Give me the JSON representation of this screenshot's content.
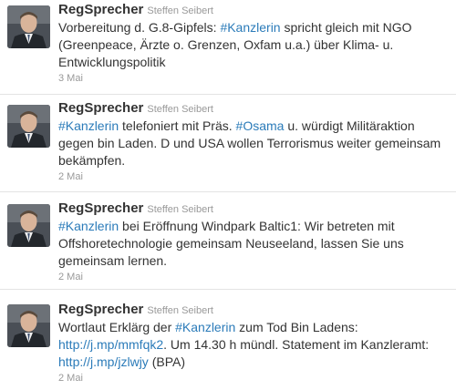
{
  "tweets": [
    {
      "screen_name": "RegSprecher",
      "full_name": "Steffen Seibert",
      "timestamp": "3 Mai",
      "parts": [
        {
          "t": "Vorbereitung d. G.8-Gipfels: "
        },
        {
          "t": "#Kanzlerin",
          "link": true
        },
        {
          "t": " spricht gleich mit NGO (Greenpeace, Ärzte o. Grenzen, Oxfam u.a.) über Klima- u. Entwicklungspolitik"
        }
      ]
    },
    {
      "screen_name": "RegSprecher",
      "full_name": "Steffen Seibert",
      "timestamp": "2 Mai",
      "parts": [
        {
          "t": "#Kanzlerin",
          "link": true
        },
        {
          "t": " telefoniert mit Präs. "
        },
        {
          "t": "#Osama",
          "link": true
        },
        {
          "t": " u. würdigt Militäraktion gegen bin Laden. D und USA wollen Terrorismus weiter gemeinsam bekämpfen."
        }
      ]
    },
    {
      "screen_name": "RegSprecher",
      "full_name": "Steffen Seibert",
      "timestamp": "2 Mai",
      "parts": [
        {
          "t": "#Kanzlerin",
          "link": true
        },
        {
          "t": " bei Eröffnung Windpark Baltic1: Wir betreten mit Offshoretechnologie gemeinsam Neuseeland, lassen Sie uns gemeinsam lernen."
        }
      ]
    },
    {
      "screen_name": "RegSprecher",
      "full_name": "Steffen Seibert",
      "timestamp": "2 Mai",
      "parts": [
        {
          "t": "Wortlaut Erklärg der "
        },
        {
          "t": "#Kanzlerin",
          "link": true
        },
        {
          "t": " zum Tod Bin Ladens: "
        },
        {
          "t": "http://j.mp/mmfqk2",
          "link": true
        },
        {
          "t": ". Um 14.30 h mündl. Statement im Kanzleramt: "
        },
        {
          "t": "http://j.mp/jzlwjy",
          "link": true
        },
        {
          "t": " (BPA)"
        }
      ]
    }
  ],
  "colors": {
    "text": "#333333",
    "link": "#2b7bb9",
    "meta": "#999999",
    "divider": "#e3e3e3"
  }
}
